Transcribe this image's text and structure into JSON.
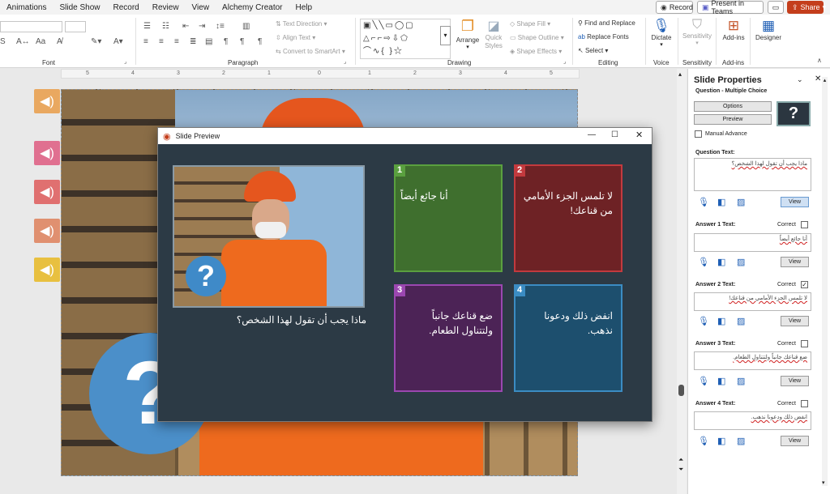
{
  "menu": [
    "Animations",
    "Slide Show",
    "Record",
    "Review",
    "View",
    "Alchemy Creator",
    "Help"
  ],
  "toolbar": {
    "record": "Record",
    "present": "Present in Teams",
    "share": "Share"
  },
  "ribbon": {
    "groups": {
      "font": "Font",
      "paragraph": "Paragraph",
      "drawing": "Drawing",
      "editing": "Editing",
      "voice": "Voice",
      "sensitivity": "Sensitivity",
      "addins": "Add-ins"
    },
    "text_direction": "Text Direction",
    "align_text": "Align Text",
    "convert_smartart": "Convert to SmartArt",
    "arrange": "Arrange",
    "quick_styles": "Quick Styles",
    "shape_fill": "Shape Fill",
    "shape_outline": "Shape Outline",
    "shape_effects": "Shape Effects",
    "find_replace": "Find and Replace",
    "replace_fonts": "Replace Fonts",
    "select": "Select",
    "dictate": "Dictate",
    "sensitivity_btn": "Sensitivity",
    "addins_btn": "Add-ins",
    "designer": "Designer"
  },
  "ruler_marks": [
    "5",
    "4",
    "3",
    "2",
    "1",
    "0",
    "1",
    "2",
    "3",
    "4",
    "5"
  ],
  "panel": {
    "title": "Slide Properties",
    "subtitle": "Question - Multiple Choice",
    "options": "Options",
    "preview": "Preview",
    "manual_advance": "Manual Advance",
    "question_label": "Question Text:",
    "question_text": "ماذا يجب أن تقول لهذا الشخص؟",
    "view": "View",
    "correct": "Correct",
    "answers": [
      {
        "label": "Answer 1 Text:",
        "text": "أنا جائع أيضاً",
        "correct": false
      },
      {
        "label": "Answer 2 Text:",
        "text": "لا تلمس الجزء الأمامي من قناعك!",
        "correct": true
      },
      {
        "label": "Answer 3 Text:",
        "text": "ضع قناعك جانباً ولتتناول الطعام.",
        "correct": false
      },
      {
        "label": "Answer 4 Text:",
        "text": "انفض ذلك ودعونا نذهب.",
        "correct": false
      }
    ]
  },
  "preview": {
    "title": "Slide Preview",
    "question": "ماذا يجب أن تقول لهذا الشخص؟",
    "tiles": [
      {
        "num": "1",
        "text": "أنا جائع أيضاً",
        "color": "#3f6f2e",
        "border": "#5aa03f",
        "badge": "#5aa03f"
      },
      {
        "num": "2",
        "text": "لا تلمس الجزء الأمامي من قناعك!",
        "color": "#6e2225",
        "border": "#c33a3e",
        "badge": "#c33a3e"
      },
      {
        "num": "3",
        "text": "ضع قناعك جانباً ولتتناول الطعام.",
        "color": "#4c2356",
        "border": "#9b47b0",
        "badge": "#9b47b0"
      },
      {
        "num": "4",
        "text": "انفض ذلك ودعونا نذهب.",
        "color": "#1d4f6e",
        "border": "#3b8cc3",
        "badge": "#3b8cc3"
      }
    ]
  },
  "colors": {
    "share": "#c43e1c",
    "accent": "#1f5fb5"
  }
}
